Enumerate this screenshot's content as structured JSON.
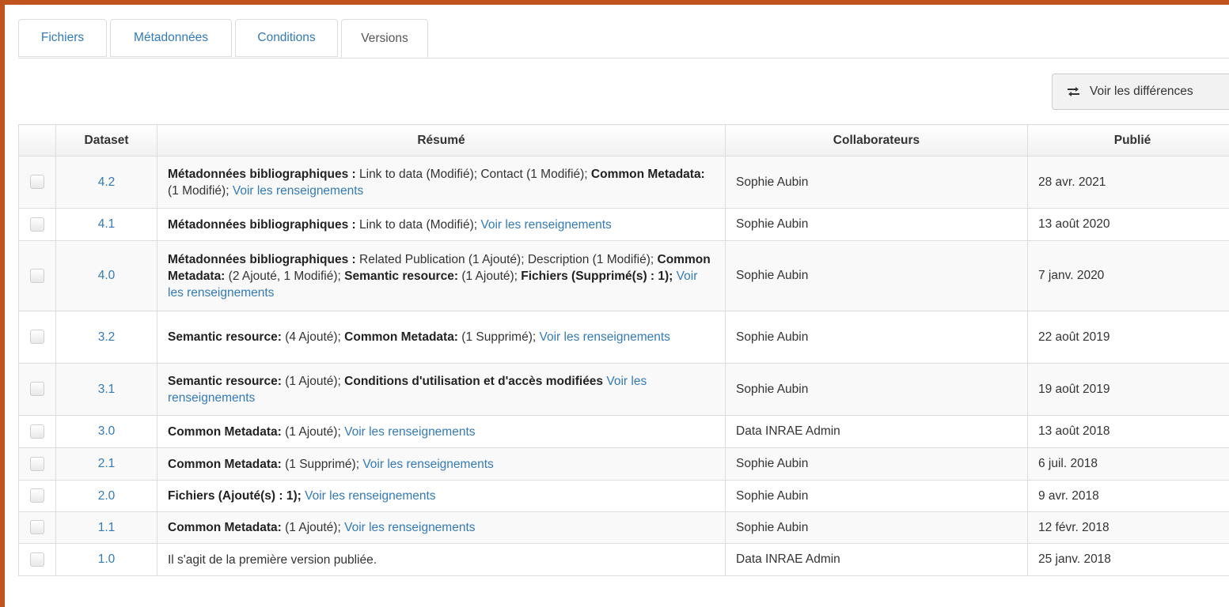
{
  "tabs": [
    {
      "label": "Fichiers"
    },
    {
      "label": "Métadonnées"
    },
    {
      "label": "Conditions"
    },
    {
      "label": "Versions"
    }
  ],
  "diff_button": {
    "label": "Voir les différences",
    "icon": "swap-arrows-icon"
  },
  "table": {
    "headers": {
      "dataset": "Dataset",
      "summary": "Résumé",
      "contributors": "Collaborateurs",
      "published": "Publié"
    },
    "rows": [
      {
        "version": "4.2",
        "contributor": "Sophie Aubin",
        "date": "28 avr. 2021",
        "height": 66,
        "summary": [
          {
            "b": true,
            "t": "Métadonnées bibliographiques : "
          },
          {
            "t": "Link to data (Modifié); Contact (1 Modifié); "
          },
          {
            "b": true,
            "t": "Common Metadata: "
          },
          {
            "t": "(1 Modifié); "
          },
          {
            "l": true,
            "t": "Voir les renseignements"
          }
        ]
      },
      {
        "version": "4.1",
        "contributor": "Sophie Aubin",
        "date": "13 août 2020",
        "height": 41,
        "summary": [
          {
            "b": true,
            "t": "Métadonnées bibliographiques : "
          },
          {
            "t": "Link to data (Modifié); "
          },
          {
            "l": true,
            "t": "Voir les renseignements"
          }
        ]
      },
      {
        "version": "4.0",
        "contributor": "Sophie Aubin",
        "date": "7 janv. 2020",
        "height": 89,
        "summary": [
          {
            "b": true,
            "t": "Métadonnées bibliographiques : "
          },
          {
            "t": "Related Publication (1 Ajouté); Description (1 Modifié); "
          },
          {
            "b": true,
            "t": "Common Metadata: "
          },
          {
            "t": "(2 Ajouté, 1 Modifié); "
          },
          {
            "b": true,
            "t": "Semantic resource: "
          },
          {
            "t": "(1 Ajouté); "
          },
          {
            "b": true,
            "t": "Fichiers (Supprimé(s) : 1); "
          },
          {
            "l": true,
            "t": "Voir les renseignements"
          }
        ]
      },
      {
        "version": "3.2",
        "contributor": "Sophie Aubin",
        "date": "22 août 2019",
        "height": 66,
        "summary": [
          {
            "b": true,
            "t": "Semantic resource: "
          },
          {
            "t": "(4 Ajouté); "
          },
          {
            "b": true,
            "t": "Common Metadata: "
          },
          {
            "t": "(1 Supprimé); "
          },
          {
            "l": true,
            "t": "Voir les renseignements"
          }
        ]
      },
      {
        "version": "3.1",
        "contributor": "Sophie Aubin",
        "date": "19 août 2019",
        "height": 66,
        "summary": [
          {
            "b": true,
            "t": "Semantic resource: "
          },
          {
            "t": "(1 Ajouté); "
          },
          {
            "b": true,
            "t": "Conditions d'utilisation et d'accès modifiées "
          },
          {
            "l": true,
            "t": "Voir les renseignements"
          }
        ]
      },
      {
        "version": "3.0",
        "contributor": "Data INRAE Admin",
        "date": "13 août 2018",
        "height": 41,
        "summary": [
          {
            "b": true,
            "t": "Common Metadata: "
          },
          {
            "t": "(1 Ajouté); "
          },
          {
            "l": true,
            "t": "Voir les renseignements"
          }
        ]
      },
      {
        "version": "2.1",
        "contributor": "Sophie Aubin",
        "date": "6 juil. 2018",
        "height": 41,
        "summary": [
          {
            "b": true,
            "t": "Common Metadata: "
          },
          {
            "t": "(1 Supprimé); "
          },
          {
            "l": true,
            "t": "Voir les renseignements"
          }
        ]
      },
      {
        "version": "2.0",
        "contributor": "Sophie Aubin",
        "date": "9 avr. 2018",
        "height": 40,
        "summary": [
          {
            "b": true,
            "t": "Fichiers (Ajouté(s) : 1); "
          },
          {
            "l": true,
            "t": "Voir les renseignements"
          }
        ]
      },
      {
        "version": "1.1",
        "contributor": "Sophie Aubin",
        "date": "12 févr. 2018",
        "height": 40,
        "summary": [
          {
            "b": true,
            "t": "Common Metadata: "
          },
          {
            "t": "(1 Ajouté); "
          },
          {
            "l": true,
            "t": "Voir les renseignements"
          }
        ]
      },
      {
        "version": "1.0",
        "contributor": "Data INRAE Admin",
        "date": "25 janv. 2018",
        "height": 41,
        "summary": [
          {
            "t": "Il s'agit de la première version publiée."
          }
        ]
      }
    ]
  }
}
